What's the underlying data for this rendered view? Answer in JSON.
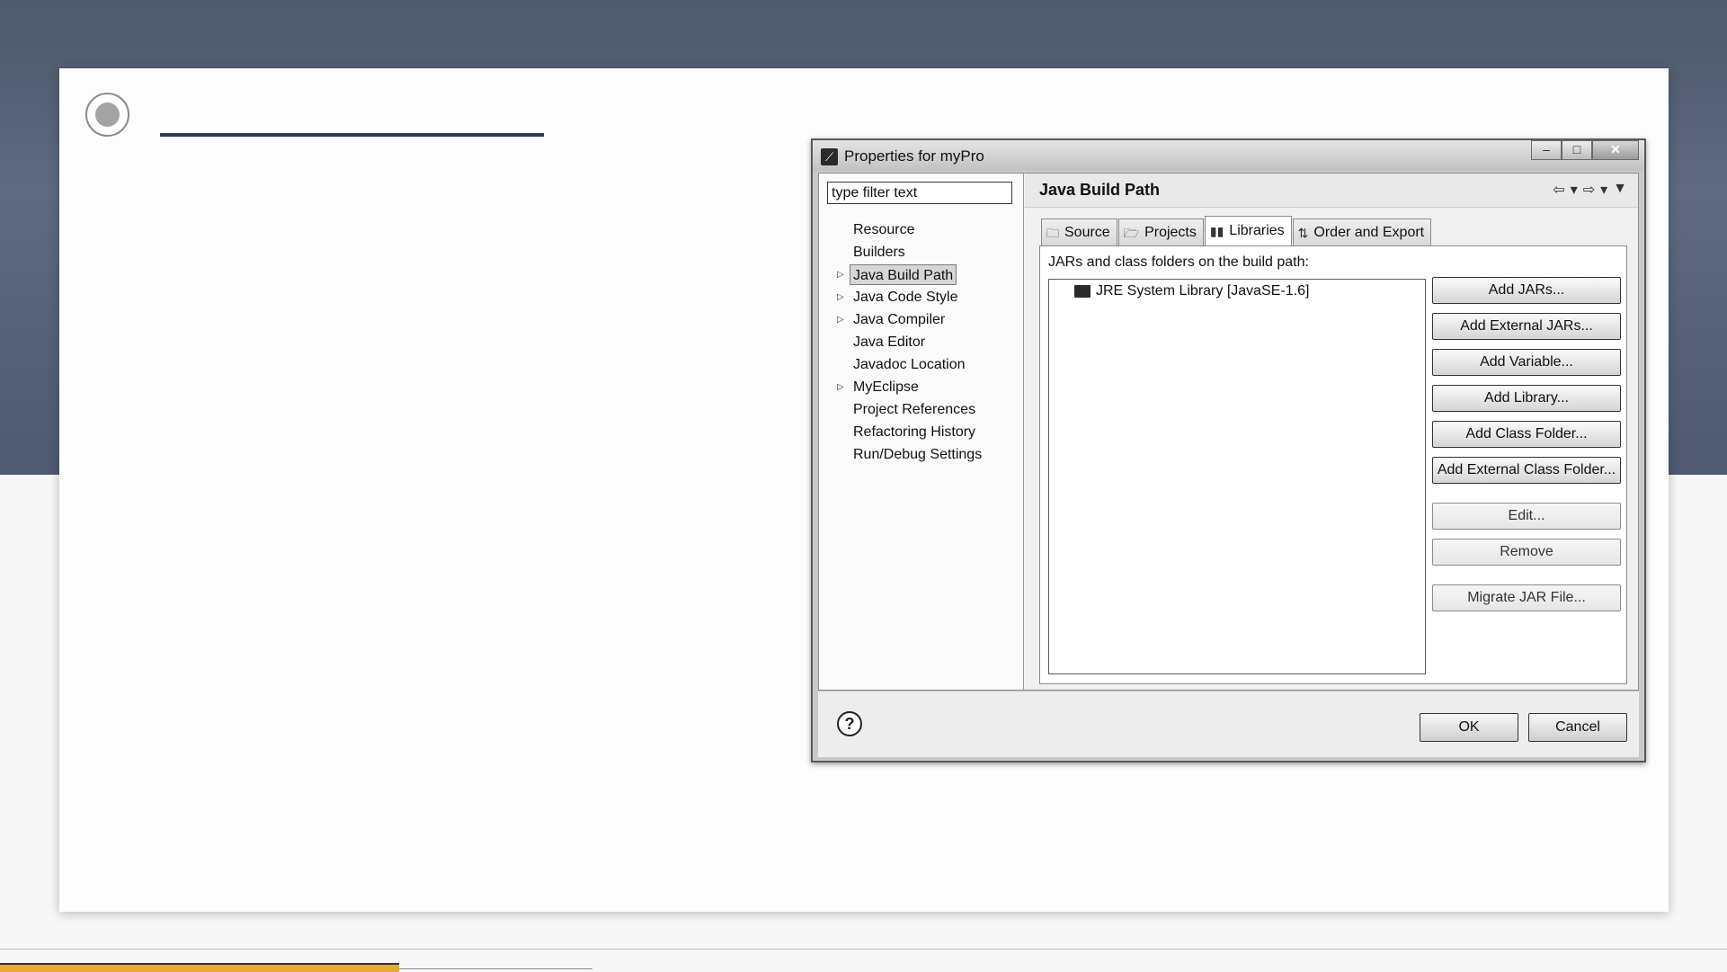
{
  "dialog": {
    "title": "Properties for myPro",
    "window_controls": {
      "minimize": "–",
      "maximize": "□",
      "close": "✕"
    }
  },
  "filter": {
    "value": "type filter text"
  },
  "tree": [
    {
      "label": "Resource",
      "expandable": false
    },
    {
      "label": "Builders",
      "expandable": false
    },
    {
      "label": "Java Build Path",
      "expandable": false,
      "selected": true
    },
    {
      "label": "Java Code Style",
      "expandable": true
    },
    {
      "label": "Java Compiler",
      "expandable": true
    },
    {
      "label": "Java Editor",
      "expandable": true
    },
    {
      "label": "Javadoc Location",
      "expandable": false
    },
    {
      "label": "MyEclipse",
      "expandable": true
    },
    {
      "label": "Project References",
      "expandable": false
    },
    {
      "label": "Refactoring History",
      "expandable": false
    },
    {
      "label": "Run/Debug Settings",
      "expandable": false
    }
  ],
  "page": {
    "title": "Java Build Path",
    "tabs": [
      {
        "label": "Source",
        "icon": "source-folder-icon"
      },
      {
        "label": "Projects",
        "icon": "projects-folder-icon"
      },
      {
        "label": "Libraries",
        "icon": "libraries-icon",
        "active": true
      },
      {
        "label": "Order and Export",
        "icon": "order-export-icon"
      }
    ],
    "libraries_label": "JARs and class folders on the build path:",
    "libraries": [
      {
        "label": "JRE System Library [JavaSE-1.6]"
      }
    ],
    "buttons": {
      "add_jars": "Add JARs...",
      "add_external_jars": "Add External JARs...",
      "add_variable": "Add Variable...",
      "add_library": "Add Library...",
      "add_class_folder": "Add Class Folder...",
      "add_external_class_folder": "Add External Class Folder...",
      "edit": "Edit...",
      "remove": "Remove",
      "migrate_jar": "Migrate JAR File..."
    }
  },
  "footer": {
    "ok": "OK",
    "cancel": "Cancel",
    "help": "?"
  }
}
